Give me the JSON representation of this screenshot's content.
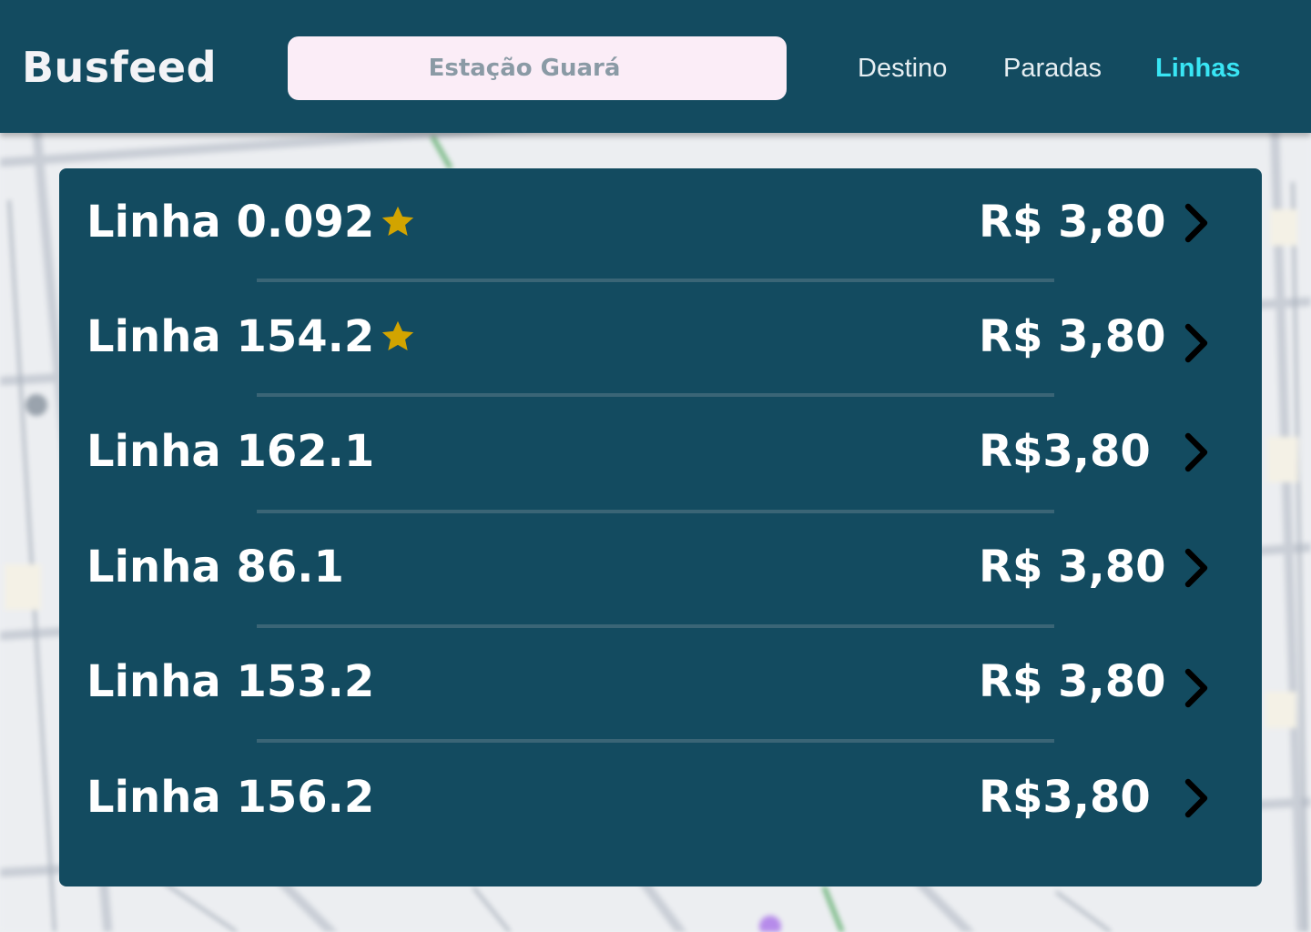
{
  "header": {
    "logo": "Busfeed",
    "search_value": "Estação Guará",
    "nav": {
      "destino": "Destino",
      "paradas": "Paradas",
      "linhas": "Linhas"
    },
    "active_nav": "linhas"
  },
  "lines": [
    {
      "name": "Linha 0.092",
      "price": "R$ 3,80",
      "favorite": true
    },
    {
      "name": "Linha 154.2",
      "price": "R$ 3,80",
      "favorite": true
    },
    {
      "name": "Linha 162.1",
      "price": "R$3,80",
      "favorite": false
    },
    {
      "name": "Linha 86.1",
      "price": "R$ 3,80",
      "favorite": false
    },
    {
      "name": "Linha 153.2",
      "price": "R$ 3,80",
      "favorite": false
    },
    {
      "name": "Linha 156.2",
      "price": "R$3,80",
      "favorite": false
    }
  ],
  "colors": {
    "primary": "#134b60",
    "active_nav": "#39e5f4",
    "star": "#d2a400",
    "search_bg": "#fbedf7"
  },
  "icons": {
    "favorite": "star-icon",
    "open": "chevron-right-icon"
  }
}
